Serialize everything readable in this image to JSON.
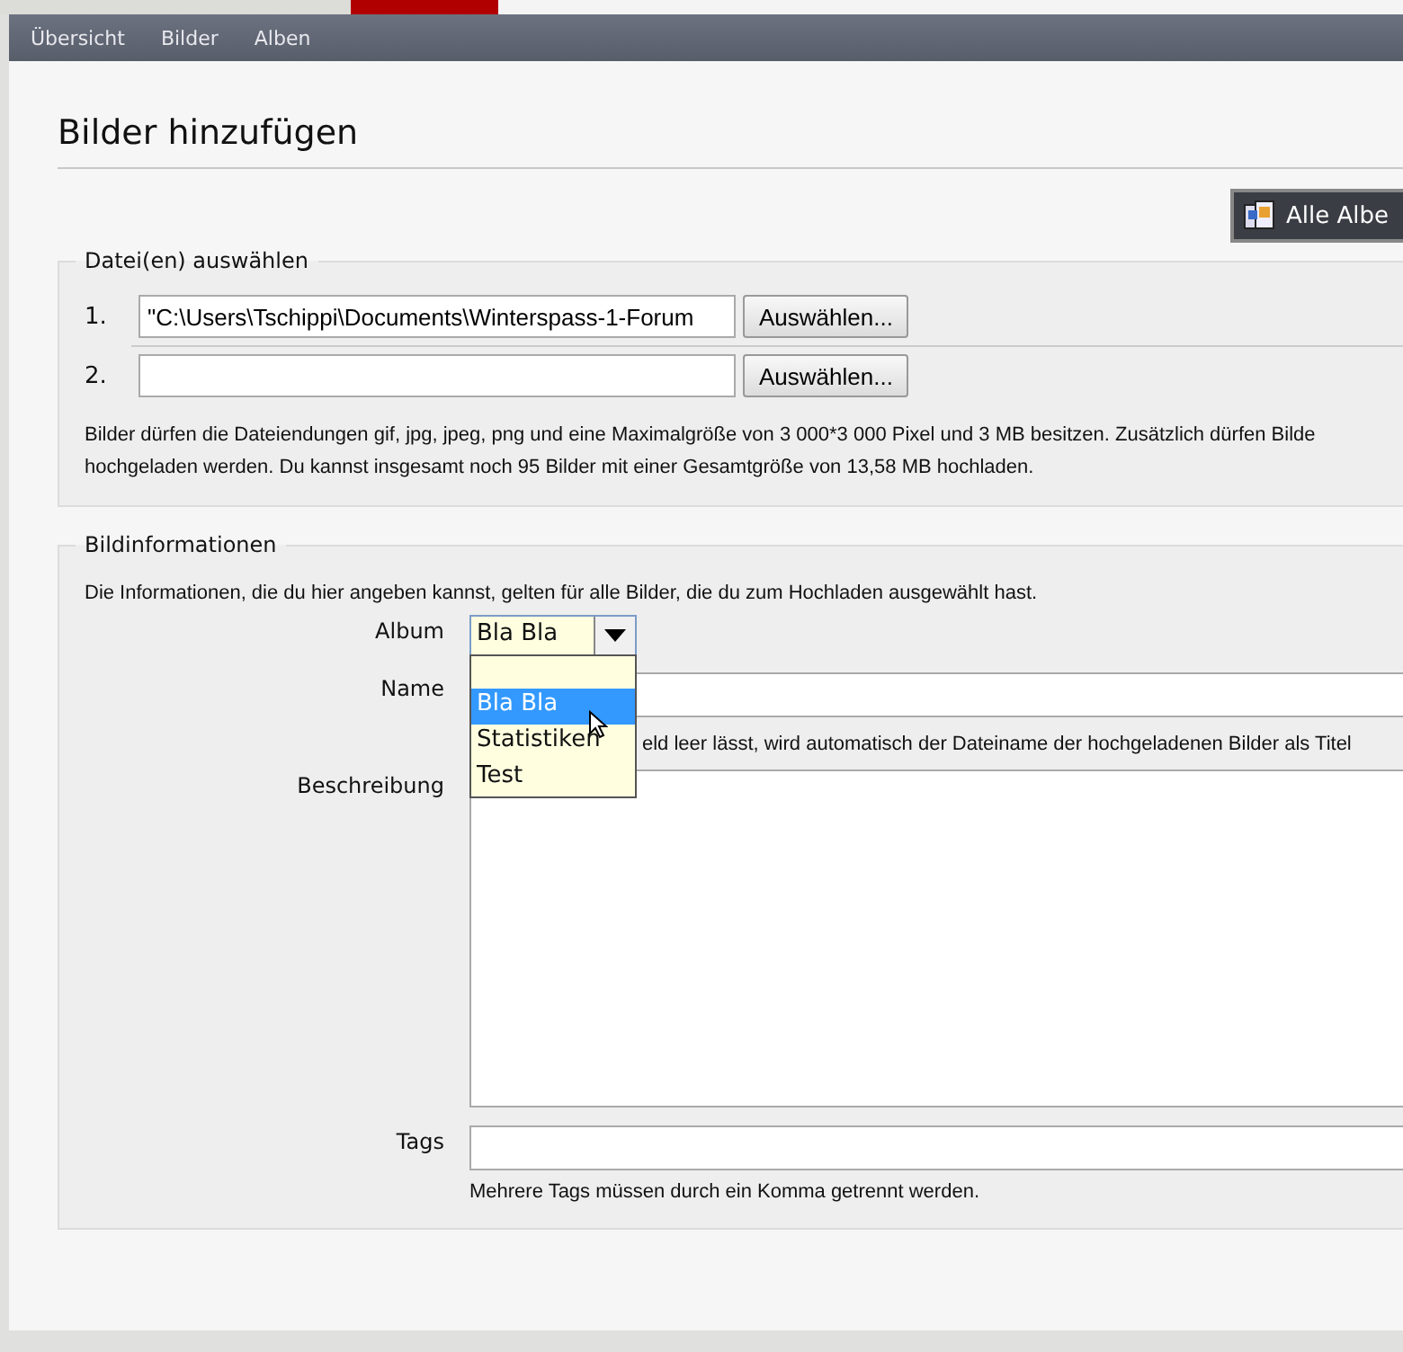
{
  "nav": [
    {
      "label": "Übersicht"
    },
    {
      "label": "Bilder"
    },
    {
      "label": "Alben"
    }
  ],
  "title": "Bilder hinzufügen",
  "all_albums_button": "Alle Albe",
  "file_section": {
    "legend": "Datei(en) auswählen",
    "files": [
      {
        "number": "1.",
        "value": "\"C:\\Users\\Tschippi\\Documents\\Winterspass-1-Forum",
        "button": "Auswählen..."
      },
      {
        "number": "2.",
        "button": "Auswählen..."
      }
    ],
    "info_lines": [
      "Bilder dürfen die Dateiendungen gif, jpg, jpeg, png und eine Maximalgröße von 3 000*3 000 Pixel und 3 MB besitzen. Zusätzlich dürfen Bilde",
      "hochgeladen werden. Du kannst insgesamt noch 95 Bilder mit einer Gesamtgröße von 13,58 MB hochladen."
    ]
  },
  "image_info": {
    "legend": "Bildinformationen",
    "description": "Die Informationen, die du hier angeben kannst, gelten für alle Bilder, die du zum Hochladen ausgewählt hast.",
    "album": {
      "label": "Album",
      "value": "Bla Bla",
      "expanded": true,
      "options": [
        {
          "label": "Bla Bla",
          "selected": true
        },
        {
          "label": "Statistiken",
          "selected": false
        },
        {
          "label": "Test",
          "selected": false
        }
      ]
    },
    "name": {
      "label": "Name",
      "hint": "eld leer lässt, wird automatisch der Dateiname der hochgeladenen Bilder als Titel"
    },
    "beschreibung": {
      "label": "Beschreibung"
    },
    "tags": {
      "label": "Tags",
      "hint": "Mehrere Tags müssen durch ein Komma getrennt werden."
    }
  }
}
